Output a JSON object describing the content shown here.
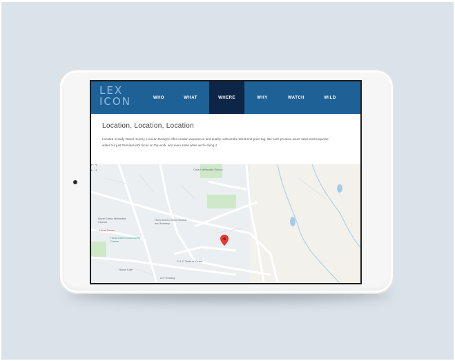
{
  "nav": {
    "logo_line1": "LEX",
    "logo_line2": "ICON",
    "items": [
      {
        "label": "WHO"
      },
      {
        "label": "WHAT"
      },
      {
        "label": "WHERE"
      },
      {
        "label": "WHY"
      },
      {
        "label": "WATCH"
      },
      {
        "label": "WILD"
      }
    ],
    "active": "WHERE"
  },
  "content": {
    "title": "Location, Location, Location",
    "body": "Located in leafy Oxted, Surrey, Lexicon Designs offer London experience and quality, without the West End price tag. We can't promise azure skies and turquoise water but just Terminal let's focus on the work, and even smile while we're doing it."
  },
  "map": {
    "labels": [
      {
        "text": "Oxted Methodist School"
      },
      {
        "text": "Hurst Green Methodist Church"
      },
      {
        "text": "Hurst Green"
      },
      {
        "text": "Hurst Green Infant School and Nursery"
      },
      {
        "text": "Hurst Green Community Centre"
      },
      {
        "text": "C & C Tools of Oxted"
      },
      {
        "text": "A H Heating"
      },
      {
        "text": "Home Cafe"
      }
    ],
    "marker_color": "#e53935",
    "icons": [
      "map-pin-icon",
      "fullscreen-icon"
    ]
  },
  "colors": {
    "nav_bg": "#1e6197",
    "nav_active": "#0d2547",
    "backdrop": "#dbe3ea"
  }
}
